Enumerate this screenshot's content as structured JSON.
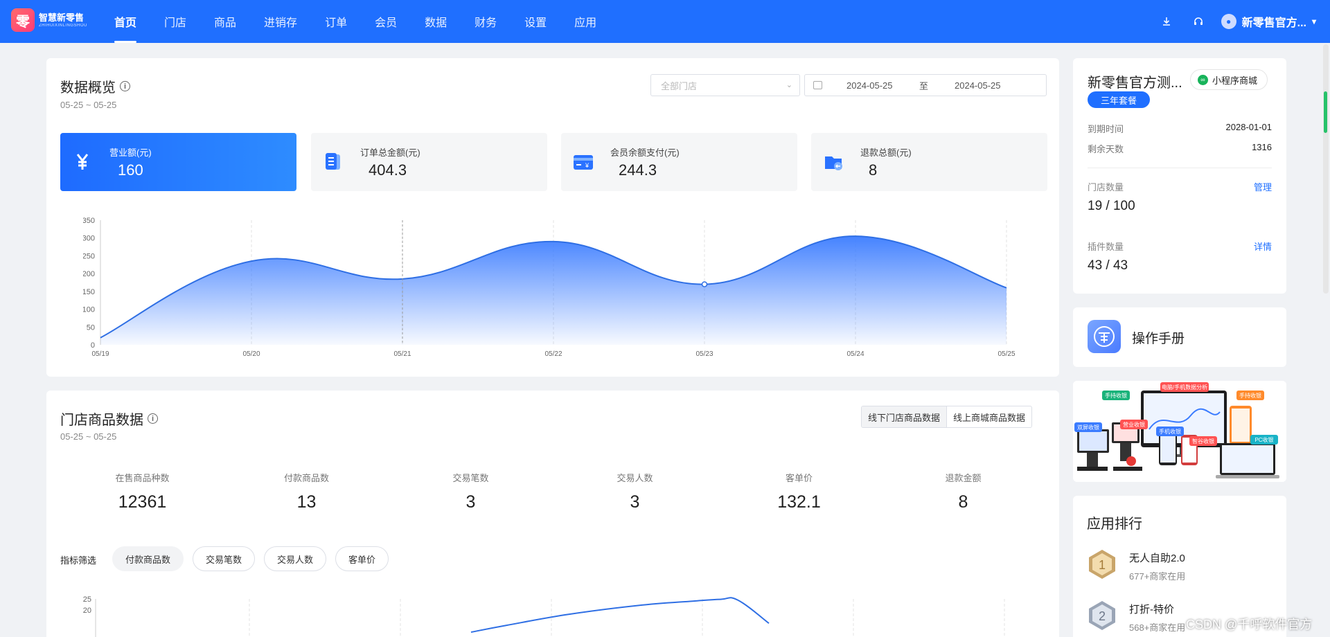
{
  "app": {
    "logo_text": "智慧新零售",
    "logo_sub": "ZHIHUIXINLINGSHOU",
    "logo_glyph": "零"
  },
  "nav": {
    "items": [
      {
        "label": "首页",
        "active": true
      },
      {
        "label": "门店"
      },
      {
        "label": "商品"
      },
      {
        "label": "进销存"
      },
      {
        "label": "订单"
      },
      {
        "label": "会员"
      },
      {
        "label": "数据"
      },
      {
        "label": "财务"
      },
      {
        "label": "设置"
      },
      {
        "label": "应用"
      }
    ],
    "user_name": "新零售官方..."
  },
  "overview": {
    "title": "数据概览",
    "date_range": "05-25 ~ 05-25",
    "store_select_placeholder": "全部门店",
    "date_from": "2024-05-25",
    "date_to_sep": "至",
    "date_to": "2024-05-25",
    "kpis": [
      {
        "label": "营业额(元)",
        "value": "160"
      },
      {
        "label": "订单总金额(元)",
        "value": "404.3"
      },
      {
        "label": "会员余额支付(元)",
        "value": "244.3"
      },
      {
        "label": "退款总额(元)",
        "value": "8"
      }
    ]
  },
  "store_goods": {
    "title": "门店商品数据",
    "date_range": "05-25 ~ 05-25",
    "toggle": [
      "线下门店商品数据",
      "线上商城商品数据"
    ],
    "stats": [
      {
        "label": "在售商品种数",
        "value": "12361"
      },
      {
        "label": "付款商品数",
        "value": "13"
      },
      {
        "label": "交易笔数",
        "value": "3"
      },
      {
        "label": "交易人数",
        "value": "3"
      },
      {
        "label": "客单价",
        "value": "132.1"
      },
      {
        "label": "退款金额",
        "value": "8"
      }
    ],
    "filter_label": "指标筛选",
    "filters": [
      {
        "label": "付款商品数",
        "active": true
      },
      {
        "label": "交易笔数"
      },
      {
        "label": "交易人数"
      },
      {
        "label": "客单价"
      }
    ]
  },
  "account": {
    "name": "新零售官方测...",
    "mini_badge": "小程序商城",
    "plan": "三年套餐",
    "expire_label": "到期时间",
    "expire_value": "2028-01-01",
    "remain_label": "剩余天数",
    "remain_value": "1316",
    "stores_label": "门店数量",
    "stores_link": "管理",
    "stores_value": "19 / 100",
    "plugins_label": "插件数量",
    "plugins_link": "详情",
    "plugins_value": "43 / 43"
  },
  "manual": {
    "label": "操作手册"
  },
  "promo_tags": [
    "手持收银",
    "电脑/手机数据分析",
    "手持收银",
    "双屏收银",
    "营业收银",
    "手机收银",
    "智谷收银",
    "PC收银"
  ],
  "ranking": {
    "title": "应用排行",
    "items": [
      {
        "rank": "1",
        "name": "无人自助2.0",
        "sub": "677+商家在用"
      },
      {
        "rank": "2",
        "name": "打折-特价",
        "sub": "568+商家在用"
      }
    ]
  },
  "watermark": "CSDN @千呼软件官方",
  "chart_data": [
    {
      "type": "area",
      "x": [
        "05/19",
        "05/20",
        "05/21",
        "05/22",
        "05/23",
        "05/24",
        "05/25"
      ],
      "values": [
        20,
        235,
        185,
        290,
        170,
        305,
        160
      ],
      "ylim": [
        0,
        350
      ],
      "yticks": [
        0,
        50,
        100,
        150,
        200,
        250,
        300,
        350
      ],
      "color": "#2f6fe4"
    },
    {
      "type": "line",
      "ylim": [
        0,
        25
      ],
      "yticks": [
        20,
        25
      ],
      "visible_values": [
        10,
        13,
        18,
        22,
        24,
        24.8,
        24.5,
        14
      ],
      "color": "#2f6fe4"
    }
  ]
}
